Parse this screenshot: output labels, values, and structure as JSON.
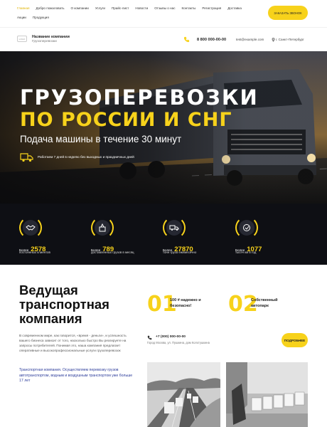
{
  "nav": {
    "items": [
      {
        "label": "Главная",
        "active": true
      },
      {
        "label": "Добро пожаловать"
      },
      {
        "label": "О компании"
      },
      {
        "label": "Услуги"
      },
      {
        "label": "Прайс-лист"
      },
      {
        "label": "Новости"
      },
      {
        "label": "Отзывы о нас"
      },
      {
        "label": "Контакты"
      },
      {
        "label": "Регистрация"
      },
      {
        "label": "Доставка"
      },
      {
        "label": "Акции"
      },
      {
        "label": "Продукция"
      }
    ],
    "cta_label": "ЗАКАЗАТЬ ЗВОНОК"
  },
  "header": {
    "logo_text": "LOGO",
    "company_name": "Название компании",
    "tagline": "Грузоперевозки",
    "phone": "8 800 000-00-00",
    "email": "test@example.com",
    "city": "г. Санкт-Петербург"
  },
  "hero": {
    "title_line1": "ГРУЗОПЕРЕВОЗКИ",
    "title_line2": "ПО РОССИИ И СНГ",
    "subtitle": "Подача машины в течение 30 минут",
    "work_note": "Работаем 7 дней в неделю без выходных и праздничных дней"
  },
  "stats": [
    {
      "prefix": "Более",
      "value": "2578",
      "caption": "постоянных клиентов",
      "icon": "handshake-icon"
    },
    {
      "prefix": "Более",
      "value": "789",
      "caption": "доставленных грузов в месяц",
      "icon": "cargo-icon"
    },
    {
      "prefix": "Более",
      "value": "27870",
      "caption": "тонн груза ежемесячно",
      "icon": "truck-icon"
    },
    {
      "prefix": "Более",
      "value": "1077",
      "caption": "тысяч км в год",
      "icon": "route-icon"
    }
  ],
  "about": {
    "title": "Ведущая транспортная компания",
    "text": "В современном мире, как говорится, «время - деньги», и успешность вашего бизнеса зависит от того, насколько быстро Вы реагируете на запросы потребителей. Понимая это, наша компания предлагает оперативные и высокопрофессиональные услуги грузоперевозок",
    "highlight": "Транспортная компания. Осуществляем перевозку грузов автотранспортом, водным и воздушным транспортом уже больше 17 лет"
  },
  "features": [
    {
      "number": "01",
      "text": "100 # надежно и безопасно!"
    },
    {
      "number": "02",
      "text": "Собственный автопарк"
    }
  ],
  "contact": {
    "phone": "+7 (000) 000-00-00",
    "address": "Город Москва, ул. Пушкина, дом Колотушкина",
    "more_label": "ПОДРОБНЕЕ"
  },
  "colors": {
    "accent": "#f7d21b",
    "dark": "#0e0f14",
    "blue_text": "#2b3b9a"
  }
}
